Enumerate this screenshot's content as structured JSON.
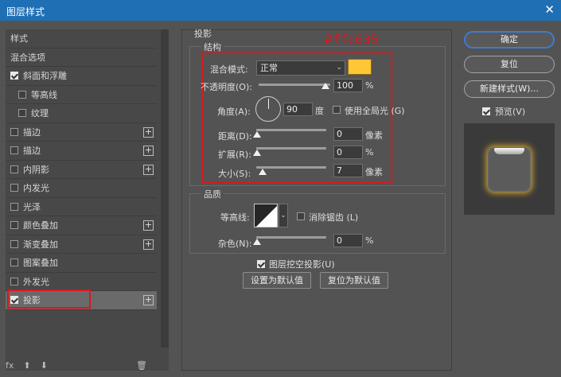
{
  "window": {
    "title": "图层样式",
    "close_glyph": "✕"
  },
  "left": {
    "items": [
      {
        "label": "样式",
        "checkbox": false,
        "checked": false,
        "plus": false,
        "sub": false,
        "header": true
      },
      {
        "label": "混合选项",
        "checkbox": false,
        "checked": false,
        "plus": false,
        "sub": false,
        "header": true
      },
      {
        "label": "斜面和浮雕",
        "checkbox": true,
        "checked": true,
        "plus": false,
        "sub": false
      },
      {
        "label": "等高线",
        "checkbox": true,
        "checked": false,
        "plus": false,
        "sub": true
      },
      {
        "label": "纹理",
        "checkbox": true,
        "checked": false,
        "plus": false,
        "sub": true
      },
      {
        "label": "描边",
        "checkbox": true,
        "checked": false,
        "plus": true,
        "sub": false
      },
      {
        "label": "描边",
        "checkbox": true,
        "checked": false,
        "plus": true,
        "sub": false
      },
      {
        "label": "内阴影",
        "checkbox": true,
        "checked": false,
        "plus": true,
        "sub": false
      },
      {
        "label": "内发光",
        "checkbox": true,
        "checked": false,
        "plus": false,
        "sub": false
      },
      {
        "label": "光泽",
        "checkbox": true,
        "checked": false,
        "plus": false,
        "sub": false
      },
      {
        "label": "颜色叠加",
        "checkbox": true,
        "checked": false,
        "plus": true,
        "sub": false
      },
      {
        "label": "渐变叠加",
        "checkbox": true,
        "checked": false,
        "plus": true,
        "sub": false
      },
      {
        "label": "图案叠加",
        "checkbox": true,
        "checked": false,
        "plus": false,
        "sub": false
      },
      {
        "label": "外发光",
        "checkbox": true,
        "checked": false,
        "plus": false,
        "sub": false
      },
      {
        "label": "投影",
        "checkbox": true,
        "checked": true,
        "plus": true,
        "sub": false,
        "selected": true
      }
    ],
    "footer": {
      "fx": "fx",
      "up": "⬆",
      "down": "⬇",
      "trash": "🗑"
    }
  },
  "main": {
    "section_title": "投影",
    "structure": {
      "title": "结构",
      "blend_mode_label": "混合模式:",
      "blend_mode_value": "正常",
      "color_annotation": "#ffc635",
      "opacity_label": "不透明度(O):",
      "opacity_value": "100",
      "opacity_unit": "%",
      "angle_label": "角度(A):",
      "angle_value": "90",
      "angle_unit": "度",
      "global_light_label": "使用全局光 (G)",
      "distance_label": "距离(D):",
      "distance_value": "0",
      "distance_unit": "像素",
      "spread_label": "扩展(R):",
      "spread_value": "0",
      "spread_unit": "%",
      "size_label": "大小(S):",
      "size_value": "7",
      "size_unit": "像素"
    },
    "quality": {
      "title": "品质",
      "contour_label": "等高线:",
      "antialias_label": "消除锯齿 (L)",
      "noise_label": "杂色(N):",
      "noise_value": "0",
      "noise_unit": "%"
    },
    "knockout_label": "图层挖空投影(U)",
    "set_default_label": "设置为默认值",
    "reset_default_label": "复位为默认值"
  },
  "right": {
    "ok_label": "确定",
    "reset_label": "复位",
    "new_style_label": "新建样式(W)...",
    "preview_label": "预览(V)"
  },
  "colors": {
    "shadow_color": "#ffc635",
    "accent": "#1f6fb5",
    "annotation": "#e0141b"
  }
}
